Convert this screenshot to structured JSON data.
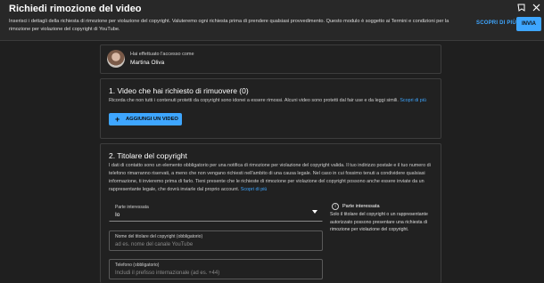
{
  "header": {
    "title": "Richiedi rimozione del video",
    "description": "Inserisci i dettagli della richiesta di rimozione per violazione del copyright. Valuteremo ogni richiesta prima di prendere qualsiasi provvedimento. Questo modulo è soggetto ai Termini e condizioni per la rimozione per violazione del copyright di YouTube.",
    "learn_more": "SCOPRI DI PIÙ",
    "send": "INVIA"
  },
  "account": {
    "signed_in_as": "Hai effettuato l'accesso come",
    "name": "Martina Oliva"
  },
  "video_section": {
    "title": "1. Video che hai richiesto di rimuovere (0)",
    "text": "Ricorda che non tutti i contenuti protetti da copyright sono idonei a essere rimossi. Alcuni video sono protetti dal fair use e da leggi simili.",
    "link": "Scopri di più",
    "add_button": "AGGIUNGI UN VIDEO"
  },
  "owner_section": {
    "title": "2. Titolare del copyright",
    "text": "I dati di contatto sono un elemento obbligatorio per una notifica di rimozione per violazione del copyright valida. Il tuo indirizzo postale e il tuo numero di telefono rimarranno riservati, a meno che non vengano richiesti nell'ambito di una causa legale. Nel caso in cui fossimo tenuti a condividere qualsiasi informazione, ti invieremo prima di farlo. Tieni presente che le richieste di rimozione per violazione del copyright possono anche essere inviate da un rappresentante legale, che dovrà inviarle dal proprio account.",
    "link": "Scopri di più",
    "party_label": "Parte interessata",
    "party_value": "Io",
    "holder_label": "Nome del titolare del copyright (obbligatorio)",
    "holder_placeholder": "ad es. nome del canale YouTube",
    "phone_label": "Telefono (obbligatorio)",
    "phone_placeholder": "Includi il prefisso internazionale (ad es. +44)",
    "info_title": "Parte interessata",
    "info_text": "Solo il titolare del copyright o un rappresentante autorizzato possono presentare una richiesta di rimozione per violazione del copyright."
  }
}
